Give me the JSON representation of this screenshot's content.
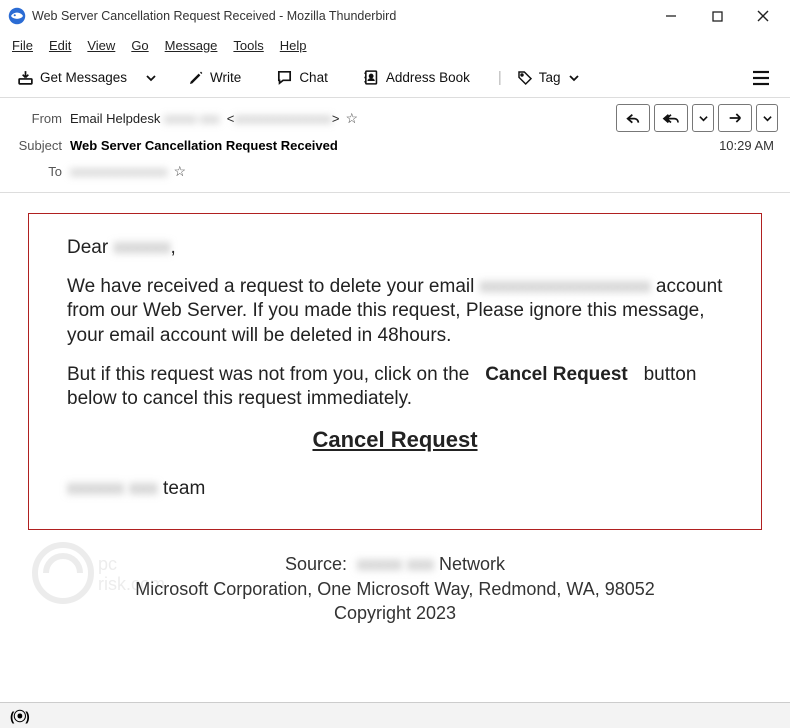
{
  "window": {
    "title": "Web Server Cancellation Request Received - Mozilla Thunderbird"
  },
  "menu": {
    "file": "File",
    "edit": "Edit",
    "view": "View",
    "go": "Go",
    "message": "Message",
    "tools": "Tools",
    "help": "Help"
  },
  "toolbar": {
    "get_messages": "Get Messages",
    "write": "Write",
    "chat": "Chat",
    "address_book": "Address Book",
    "tag": "Tag"
  },
  "header": {
    "from_label": "From",
    "from_name": "Email Helpdesk",
    "from_redacted1": "xxxxx xxx",
    "from_redacted2": "xxxxxxxxxxxxxxx",
    "subject_label": "Subject",
    "subject_value": "Web Server Cancellation Request Received",
    "to_label": "To",
    "to_redacted": "xxxxxxxxxxxxxxx",
    "time": "10:29 AM"
  },
  "body": {
    "greeting_pre": "Dear ",
    "greeting_redacted": "xxxxxx",
    "greeting_post": ",",
    "p1a": "We have received a request to delete your email ",
    "p1_redacted": "xxxxxxxxxxxxxxxxxx",
    "p1b": " account from our Web Server. If you made this request, Please ignore this message, your email account will be deleted in 48hours.",
    "p2a": "But if this request was not from you, click on the ",
    "p2b": "Cancel Request",
    "p2c": " button below to cancel this request immediately.",
    "cancel_link": "Cancel Request",
    "team_redacted": "xxxxxx xxx",
    "team_suffix": " team"
  },
  "footer": {
    "source_label": "Source:",
    "source_redacted": "xxxxx xxx",
    "source_suffix": " Network",
    "addr": "Microsoft Corporation, One Microsoft Way, Redmond, WA,  98052",
    "copyright": "Copyright 2023"
  }
}
